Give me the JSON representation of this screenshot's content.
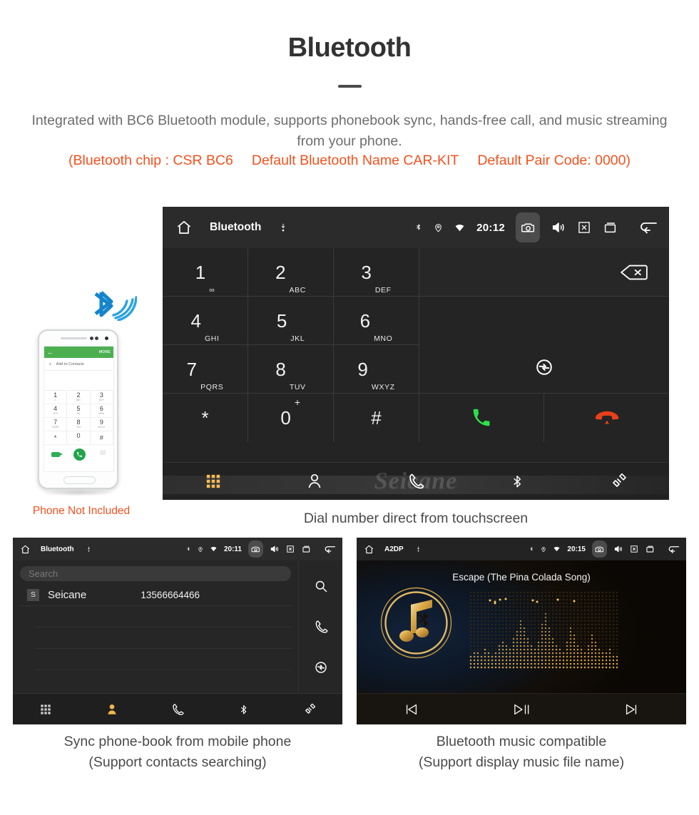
{
  "header": {
    "title": "Bluetooth",
    "intro": "Integrated with BC6 Bluetooth module, supports phonebook sync, hands-free call, and music streaming from your phone.",
    "specs": [
      "(Bluetooth chip : CSR BC6",
      "Default Bluetooth Name CAR-KIT",
      "Default Pair Code: 0000)"
    ],
    "accent_color": "#f4511e",
    "text_color": "#6d6d6d"
  },
  "dialer": {
    "statusbar": {
      "home_icon": "home-icon",
      "title": "Bluetooth",
      "usb_icon": "usb-icon",
      "bluetooth_icon": "bluetooth-icon",
      "location_icon": "location-icon",
      "wifi_icon": "wifi-icon",
      "time": "20:12",
      "camera_icon": "camera-icon",
      "volume_icon": "volume-icon",
      "close_icon": "close-box-icon",
      "recents_icon": "recents-icon",
      "back_icon": "back-icon"
    },
    "keys": [
      {
        "num": "1",
        "sub": "∞"
      },
      {
        "num": "2",
        "sub": "ABC"
      },
      {
        "num": "3",
        "sub": "DEF"
      },
      {
        "num": "4",
        "sub": "GHI"
      },
      {
        "num": "5",
        "sub": "JKL"
      },
      {
        "num": "6",
        "sub": "MNO"
      },
      {
        "num": "7",
        "sub": "PQRS"
      },
      {
        "num": "8",
        "sub": "TUV"
      },
      {
        "num": "9",
        "sub": "WXYZ"
      },
      {
        "num": "*",
        "sub": ""
      },
      {
        "num": "0",
        "sub": "+"
      },
      {
        "num": "#",
        "sub": ""
      }
    ],
    "backspace_icon": "backspace-icon",
    "sync_icon": "sync-icon",
    "call_icon": "call-icon",
    "hangup_icon": "hangup-icon",
    "call_color": "#2ee04a",
    "hangup_color": "#e8401a",
    "nav": [
      {
        "icon": "keypad-icon",
        "active": true
      },
      {
        "icon": "contacts-icon",
        "active": false
      },
      {
        "icon": "phone-icon",
        "active": false
      },
      {
        "icon": "bluetooth-icon",
        "active": false
      },
      {
        "icon": "link-icon",
        "active": false
      }
    ],
    "watermark": "Seicane",
    "active_color": "#f2b64c",
    "caption": "Dial number direct from touchscreen"
  },
  "phone_mock": {
    "green_bar_back_icon": "back-arrow-icon",
    "green_bar_more": "MORE",
    "add_contacts_label": "Add to Contacts",
    "keys": [
      {
        "num": "1",
        "sub": "∞"
      },
      {
        "num": "2",
        "sub": "ABC"
      },
      {
        "num": "3",
        "sub": "DEF"
      },
      {
        "num": "4",
        "sub": "GHI"
      },
      {
        "num": "5",
        "sub": "JKL"
      },
      {
        "num": "6",
        "sub": "MNO"
      },
      {
        "num": "7",
        "sub": "PQRS"
      },
      {
        "num": "8",
        "sub": "TUV"
      },
      {
        "num": "9",
        "sub": "WXYZ"
      },
      {
        "num": "*",
        "sub": ""
      },
      {
        "num": "0",
        "sub": "+"
      },
      {
        "num": "#",
        "sub": ""
      }
    ],
    "hide_icon": "hide-keypad-icon",
    "call_icon": "call-icon",
    "keypad_icon": "keypad-icon",
    "bluetooth_wave_icon": "bluetooth-signal-icon",
    "not_included_label": "Phone Not Included",
    "green": "#4caf50"
  },
  "phonebook": {
    "statusbar": {
      "title": "Bluetooth",
      "time": "20:11"
    },
    "search_placeholder": "Search",
    "contacts": [
      {
        "initial": "S",
        "name": "Seicane",
        "number": "13566664466"
      }
    ],
    "side_icons": [
      "search-icon",
      "phone-icon",
      "sync-icon"
    ],
    "nav": [
      {
        "icon": "keypad-icon",
        "active": false
      },
      {
        "icon": "contacts-icon",
        "active": true
      },
      {
        "icon": "phone-icon",
        "active": false
      },
      {
        "icon": "bluetooth-icon",
        "active": false
      },
      {
        "icon": "link-icon",
        "active": false
      }
    ],
    "caption_line1": "Sync phone-book from mobile phone",
    "caption_line2": "(Support contacts searching)"
  },
  "music": {
    "statusbar": {
      "title": "A2DP",
      "time": "20:15"
    },
    "song_title": "Escape (The Pina Colada Song)",
    "album_icon": "music-note-bluetooth-icon",
    "equalizer_icon": "equalizer-dots",
    "controls": [
      {
        "icon": "previous-track-icon"
      },
      {
        "icon": "play-pause-icon"
      },
      {
        "icon": "next-track-icon"
      }
    ],
    "accent": "#d9a441",
    "caption_line1": "Bluetooth music compatible",
    "caption_line2": "(Support display music file name)"
  }
}
